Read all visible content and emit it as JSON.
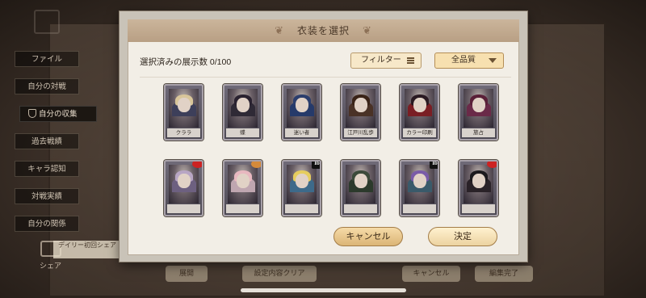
{
  "background": {
    "side_menu": [
      "ファイル",
      "自分の対戦",
      "自分の収集",
      "過去戦績",
      "キャラ認知",
      "対戦実績",
      "自分の関係"
    ],
    "active_menu_index": 2,
    "share_label": "シェア",
    "daily_banner": "デイリー初回シェア",
    "bottom_buttons": [
      "展開",
      "設定内容クリア",
      "キャンセル",
      "編集完了"
    ]
  },
  "modal": {
    "title": "衣装を選択",
    "title_deco": "❦",
    "count_label": "選択済みの展示数 0/100",
    "filter_label": "フィルター",
    "quality_label": "全品質",
    "cancel_label": "キャンセル",
    "ok_label": "決定",
    "cards": [
      {
        "name": "クララ",
        "hair": "#d9c69a",
        "body": "#3d3f5a"
      },
      {
        "name": "蝶",
        "hair": "#2a2230",
        "body": "#2f2a36"
      },
      {
        "name": "迷い者",
        "hair": "#2c3e6d",
        "body": "#263a6a"
      },
      {
        "name": "江戸川乱歩",
        "hair": "#3a2418",
        "body": "#4a3226"
      },
      {
        "name": "カラー印刷",
        "hair": "#2a1a22",
        "body": "#7a1e24"
      },
      {
        "name": "旅占",
        "hair": "#5a2038",
        "body": "#6a2a48"
      },
      {
        "name": "",
        "hair": "#b8a6c4",
        "body": "#6d6080",
        "deco": "#c22"
      },
      {
        "name": "",
        "hair": "#e8b8c0",
        "body": "#bfa6b0",
        "deco": "#d58a3a"
      },
      {
        "name": "",
        "hair": "#e6cd5e",
        "body": "#3d6a8a",
        "badge": "Ib"
      },
      {
        "name": "",
        "hair": "#3c4a3a",
        "body": "#2c3a2c"
      },
      {
        "name": "",
        "hair": "#7a5ca8",
        "body": "#3a5a6a",
        "badge": "Ib"
      },
      {
        "name": "",
        "hair": "#1c1a1e",
        "body": "#2a2228",
        "deco": "#c22"
      }
    ]
  }
}
